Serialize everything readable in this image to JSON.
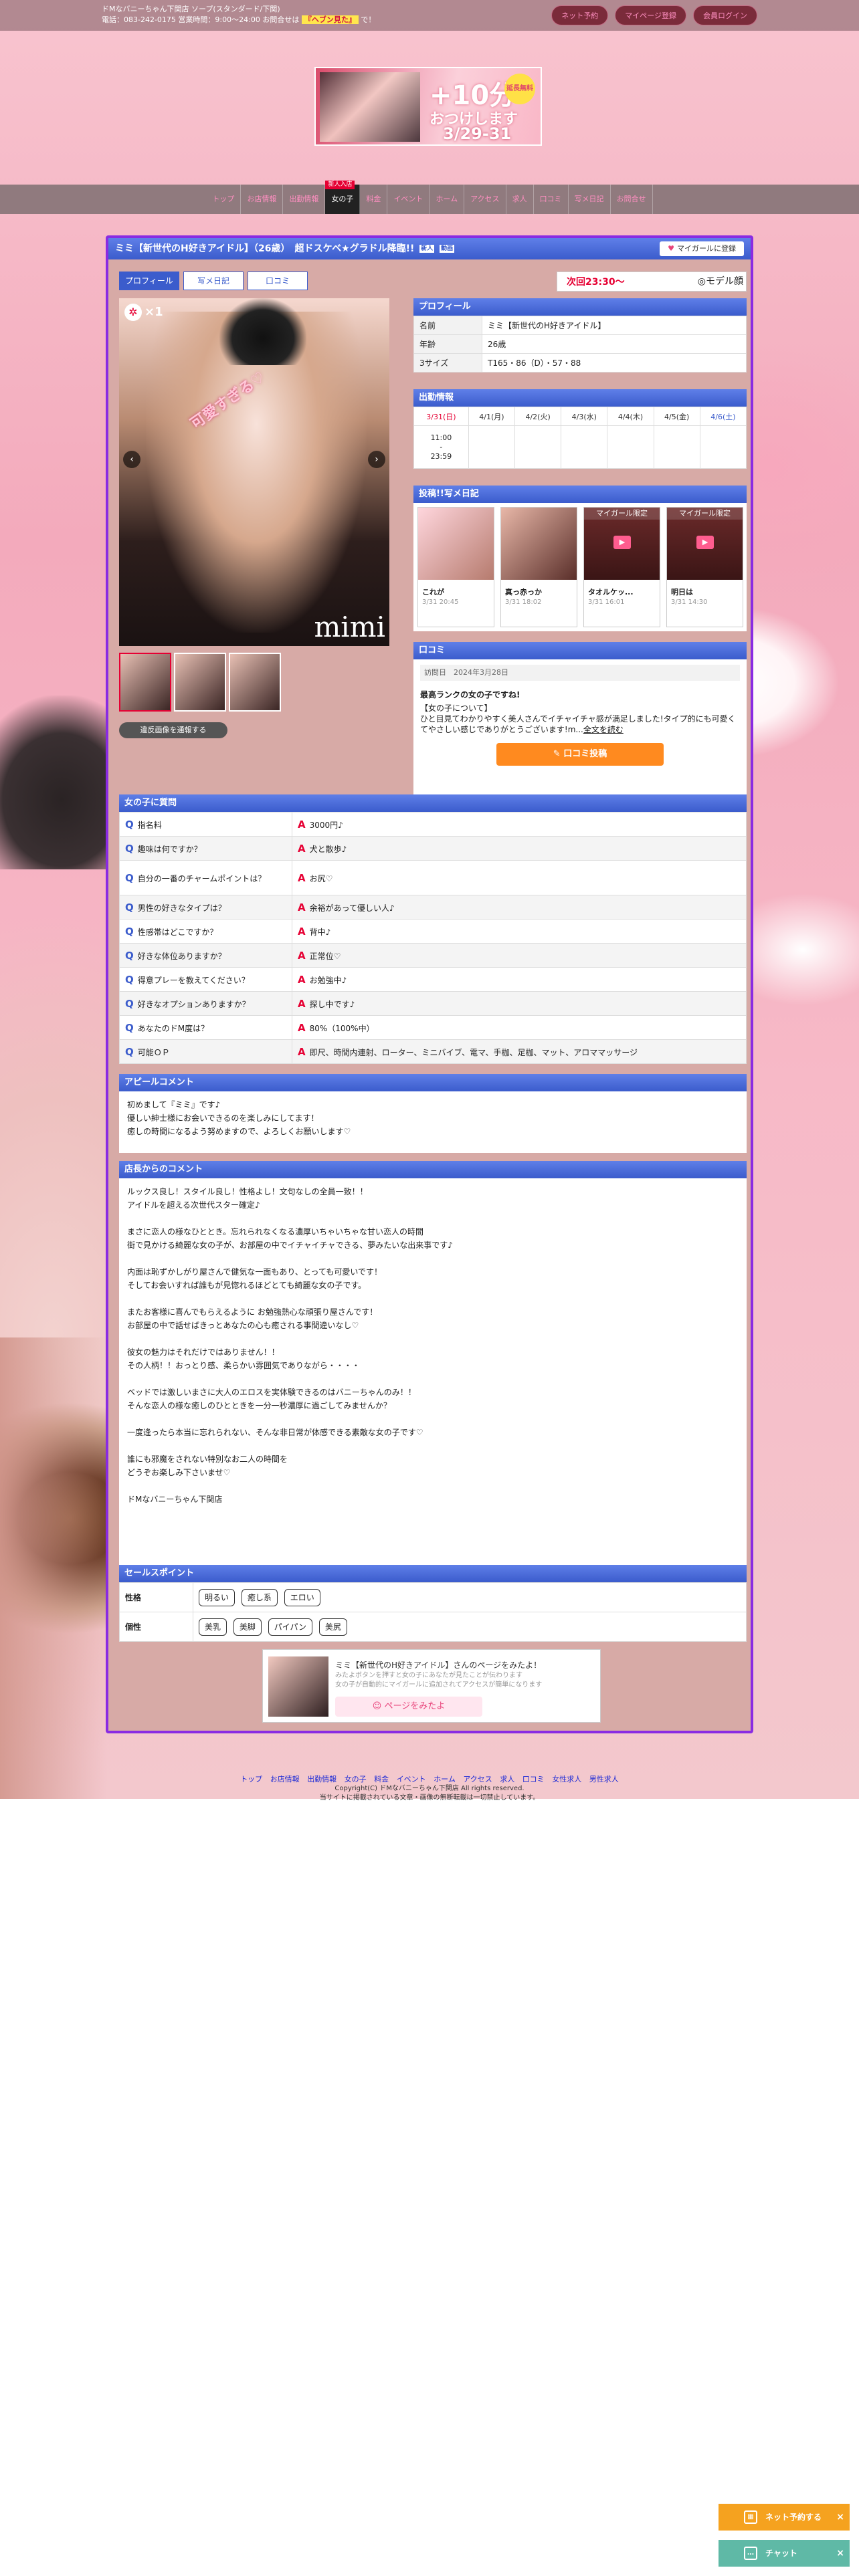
{
  "header": {
    "info_line1": "ドMなバニーちゃん下関店 ソープ(スタンダード/下関)",
    "info_line2_prefix": "電話：083-242-0175 営業時間：9:00〜24:00 お問合せは",
    "info_line2_highlight": "『ヘブン見た』",
    "info_line2_suffix": "で！",
    "buttons": [
      "ネット予約",
      "マイページ登録",
      "会員ログイン"
    ]
  },
  "banner": {
    "big": "+10分",
    "sub": "おつけします",
    "date": "3/29-31",
    "badge": "延長無料"
  },
  "nav": {
    "new_label": "新人入店",
    "items": [
      "トップ",
      "お店情報",
      "出勤情報",
      "女の子",
      "料金",
      "イベント",
      "ホーム",
      "アクセス",
      "求人",
      "口コミ",
      "写メ日記",
      "お問合せ"
    ],
    "active_index": 3
  },
  "profile": {
    "title": "ミミ【新世代のH好きアイドル】（26歳）　超ドスケベ★グラドル降臨!!",
    "title_badges": [
      "新人",
      "動画"
    ],
    "favorite_button": "マイガールに登録",
    "tabs": [
      "プロフィール",
      "写メ日記",
      "口コミ"
    ],
    "next_label": "次回23:30〜",
    "model_label": "◎モデル顔",
    "photo_counter": "×1",
    "photo_ribbon": "可愛すぎる♡",
    "photo_signature": "mimi",
    "report_button": "違反画像を通報する",
    "section_profile": "プロフィール",
    "fields": [
      {
        "k": "名前",
        "v": "ミミ【新世代のH好きアイドル】"
      },
      {
        "k": "年齢",
        "v": "26歳"
      },
      {
        "k": "3サイズ",
        "v": "T165・86（D）・57・88"
      }
    ],
    "section_schedule": "出勤情報",
    "schedule_days": [
      "3/31(日)",
      "4/1(月)",
      "4/2(火)",
      "4/3(水)",
      "4/4(木)",
      "4/5(金)",
      "4/6(土)"
    ],
    "schedule_first": "11:00\n-\n23:59",
    "section_diary": "投稿!!写メ日記",
    "diary": [
      {
        "title": "これが",
        "date": "3/31 20:45",
        "overlay": ""
      },
      {
        "title": "真っ赤っか",
        "date": "3/31 18:02",
        "overlay": ""
      },
      {
        "title": "タオルケッ...",
        "date": "3/31 16:01",
        "overlay": "マイガール限定"
      },
      {
        "title": "明日は",
        "date": "3/31 14:30",
        "overlay": "マイガール限定"
      }
    ],
    "section_review": "口コミ",
    "review": {
      "meta": "訪問日　2024年3月28日",
      "title": "最高ランクの女の子ですね!",
      "body": "【女の子について】\nひと目見てわかりやすく美人さんでイチャイチャ感が満足しました!タイプ的にも可愛くてやさしい感じでありがとうございます!m...",
      "more": "全文を読む",
      "post_button": "口コミ投稿"
    }
  },
  "qa": {
    "section": "女の子に質問",
    "rows": [
      {
        "q": "指名料",
        "a": "3000円♪"
      },
      {
        "q": "趣味は何ですか？",
        "a": "犬と散歩♪"
      },
      {
        "q": "自分の一番のチャームポイントは？",
        "a": "お尻♡"
      },
      {
        "q": "男性の好きなタイプは？",
        "a": "余裕があって優しい人♪"
      },
      {
        "q": "性感帯はどこですか？",
        "a": "背中♪"
      },
      {
        "q": "好きな体位ありますか？",
        "a": "正常位♡"
      },
      {
        "q": "得意プレーを教えてください？",
        "a": "お勉強中♪"
      },
      {
        "q": "好きなオプションありますか？",
        "a": "探し中です♪"
      },
      {
        "q": "あなたのドM度は？",
        "a": "80%（100%中）"
      },
      {
        "q": "可能ＯＰ",
        "a": "即尺、時間内連射、ローター、ミニバイブ、電マ、手枷、足枷、マット、アロママッサージ"
      }
    ]
  },
  "appeal": {
    "section": "アピールコメント",
    "text": "初めまして『ミミ』です♪\n優しい紳士様にお会いできるのを楽しみにしてます！\n癒しの時間になるよう努めますので、よろしくお願いします♡"
  },
  "manager": {
    "section": "店長からのコメント",
    "text": "ルックス良し！スタイル良し！性格よし！文句なしの全員一致！！\nアイドルを超える次世代スター確定♪\n\nまさに恋人の様なひととき。忘れられなくなる濃厚いちゃいちゃな甘い恋人の時間\n街で見かける綺麗な女の子が、お部屋の中でイチャイチャできる、夢みたいな出来事です♪\n\n内面は恥ずかしがり屋さんで健気な一面もあり、とっても可愛いです！\nそしてお会いすれば誰もが見惚れるほどとても綺麗な女の子です。\n\nまたお客様に喜んでもらえるように お勉強熱心な頑張り屋さんです！\nお部屋の中で話せばきっとあなたの心も癒される事間違いなし♡\n\n彼女の魅力はそれだけではありません！！\nその人柄！！おっとり感、柔らかい雰囲気でありながら・・・・\n\nベッドでは激しいまさに大人のエロスを実体験できるのはバニーちゃんのみ！！\nそんな恋人の様な癒しのひとときを一分一秒濃厚に過ごしてみませんか？\n\n一度逢ったら本当に忘れられない、そんな非日常が体感できる素敵な女の子です♡\n\n誰にも邪魔をされない特別なお二人の時間を\nどうぞお楽しみ下さいませ♡\n\nドMなバニーちゃん下関店"
  },
  "sales": {
    "section": "セールスポイント",
    "rows": [
      {
        "k": "性格",
        "chips": [
          "明るい",
          "癒し系",
          "エロい"
        ]
      },
      {
        "k": "個性",
        "chips": [
          "美乳",
          "美脚",
          "パイパン",
          "美尻"
        ]
      }
    ]
  },
  "promo": {
    "title": "ミミ【新世代のH好きアイドル】さんのページをみたよ！",
    "desc": "みたよボタンを押すと女の子にあなたが見たことが伝わります\n女の子が自動的にマイガールに追加されてアクセスが簡単になります",
    "button": "ページをみたよ"
  },
  "footer": {
    "links": [
      "トップ",
      "お店情報",
      "出勤情報",
      "女の子",
      "料金",
      "イベント",
      "ホーム",
      "アクセス",
      "求人",
      "口コミ",
      "女性求人",
      "男性求人"
    ],
    "copy1": "Copyright(C) ドMなバニーちゃん下関店 All rights reserved.",
    "copy2": "当サイトに掲載されている文章・画像の無断転載は一切禁止しています。"
  },
  "floating": {
    "net": "ネット予約する",
    "chat": "チャット"
  },
  "colors": {
    "accent": "#3b5ccc",
    "panel_border": "#8a2be2",
    "danger": "#e60033",
    "post": "#ff8a1f"
  }
}
